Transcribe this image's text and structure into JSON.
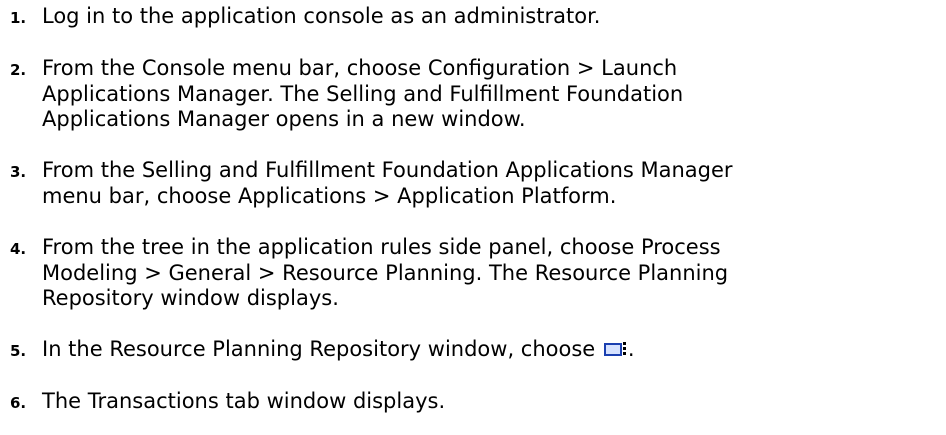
{
  "steps": [
    {
      "number": "1.",
      "lines": [
        "Log in to the application console as an administrator."
      ]
    },
    {
      "number": "2.",
      "lines": [
        "From the Console menu bar, choose Configuration > Launch",
        "Applications Manager. The Selling and Fulfillment Foundation",
        "Applications Manager opens in a new window."
      ]
    },
    {
      "number": "3.",
      "lines": [
        "From the Selling and Fulfillment Foundation Applications Manager",
        "menu bar, choose Applications > Application Platform."
      ]
    },
    {
      "number": "4.",
      "lines": [
        "From the tree in the application rules side panel, choose Process",
        "Modeling > General > Resource Planning. The Resource Planning",
        "Repository window displays."
      ]
    },
    {
      "number": "5.",
      "lines": [
        "In the Resource Planning Repository window, choose "
      ],
      "trailing_icon": "details-view-icon",
      "trailing_text": "."
    },
    {
      "number": "6.",
      "lines": [
        "The Transactions tab window displays."
      ]
    }
  ]
}
